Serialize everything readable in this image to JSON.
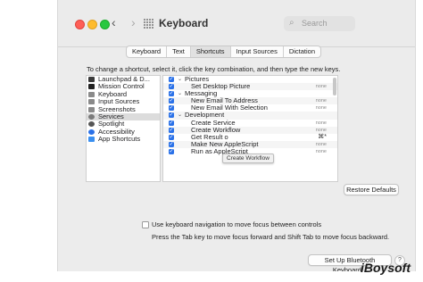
{
  "window": {
    "title": "Keyboard"
  },
  "search": {
    "placeholder": "Search"
  },
  "tabs": [
    {
      "label": "Keyboard",
      "active": false
    },
    {
      "label": "Text",
      "active": false
    },
    {
      "label": "Shortcuts",
      "active": true
    },
    {
      "label": "Input Sources",
      "active": false
    },
    {
      "label": "Dictation",
      "active": false
    }
  ],
  "instruction": "To change a shortcut, select it, click the key combination, and then type the new keys.",
  "categories": [
    {
      "label": "Launchpad & D...",
      "icon": "launchpad-icon",
      "color": "#3a3a3a"
    },
    {
      "label": "Mission Control",
      "icon": "mission-control-icon",
      "color": "#222222"
    },
    {
      "label": "Keyboard",
      "icon": "keyboard-icon",
      "color": "#8a8a8a"
    },
    {
      "label": "Input Sources",
      "icon": "input-sources-icon",
      "color": "#8a8a8a"
    },
    {
      "label": "Screenshots",
      "icon": "screenshots-icon",
      "color": "#8a8a8a"
    },
    {
      "label": "Services",
      "icon": "gear-icon",
      "color": "#7a7a7a",
      "selected": true
    },
    {
      "label": "Spotlight",
      "icon": "spotlight-icon",
      "color": "#555555"
    },
    {
      "label": "Accessibility",
      "icon": "accessibility-icon",
      "color": "#2a71e8"
    },
    {
      "label": "App Shortcuts",
      "icon": "app-shortcuts-icon",
      "color": "#3a8ff0"
    }
  ],
  "shortcuts": [
    {
      "type": "group",
      "label": "Pictures"
    },
    {
      "type": "item",
      "label": "Set Desktop Picture",
      "shortcut": "none"
    },
    {
      "type": "group",
      "label": "Messaging"
    },
    {
      "type": "item",
      "label": "New Email To Address",
      "shortcut": "none"
    },
    {
      "type": "item",
      "label": "New Email With Selection",
      "shortcut": "none"
    },
    {
      "type": "group",
      "label": "Development"
    },
    {
      "type": "item",
      "label": "Create Service",
      "shortcut": "none"
    },
    {
      "type": "item",
      "label": "Create Workflow",
      "shortcut": "none"
    },
    {
      "type": "item",
      "label": "Get Result o",
      "shortcut": "⌘*"
    },
    {
      "type": "item",
      "label": "Make New AppleScript",
      "shortcut": "none"
    },
    {
      "type": "item",
      "label": "Run as AppleScript",
      "shortcut": "none"
    }
  ],
  "tooltip": "Create Workflow",
  "restore_button": "Restore Defaults",
  "keyboard_nav": {
    "checkbox_label": "Use keyboard navigation to move focus between controls",
    "note": "Press the Tab key to move focus forward and Shift Tab to move focus backward."
  },
  "bluetooth_button": "Set Up Bluetooth Keyboard...",
  "help_button": "?",
  "watermark": "iBoysoft"
}
